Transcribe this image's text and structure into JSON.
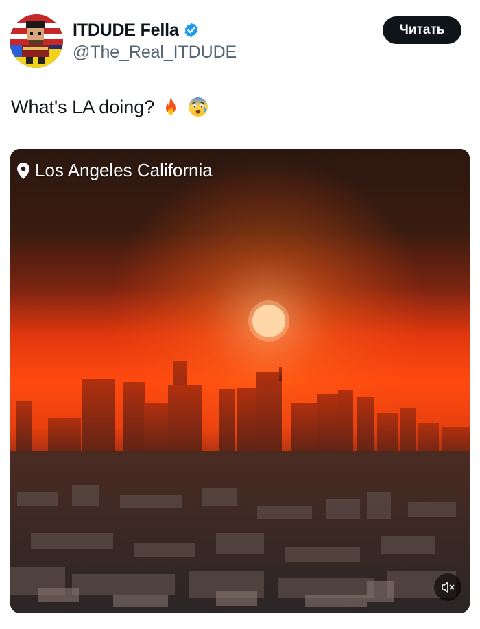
{
  "author": {
    "display_name": "ITDUDE Fella",
    "handle": "@The_Real_ITDUDE",
    "verified": true,
    "avatar_icon": "avatar-image"
  },
  "follow_button": {
    "label": "Читать"
  },
  "tweet": {
    "text": "What's LA doing?",
    "emojis": [
      "fire-emoji",
      "anxious-face-emoji"
    ]
  },
  "media": {
    "location_label": "Los Angeles California",
    "location_icon": "map-pin-icon",
    "mute_icon": "muted-speaker-icon"
  },
  "colors": {
    "brand_dark": "#0f1419",
    "secondary_text": "#536471",
    "verified_blue": "#1d9bf0",
    "sky_orange": "#ff4a0f"
  }
}
